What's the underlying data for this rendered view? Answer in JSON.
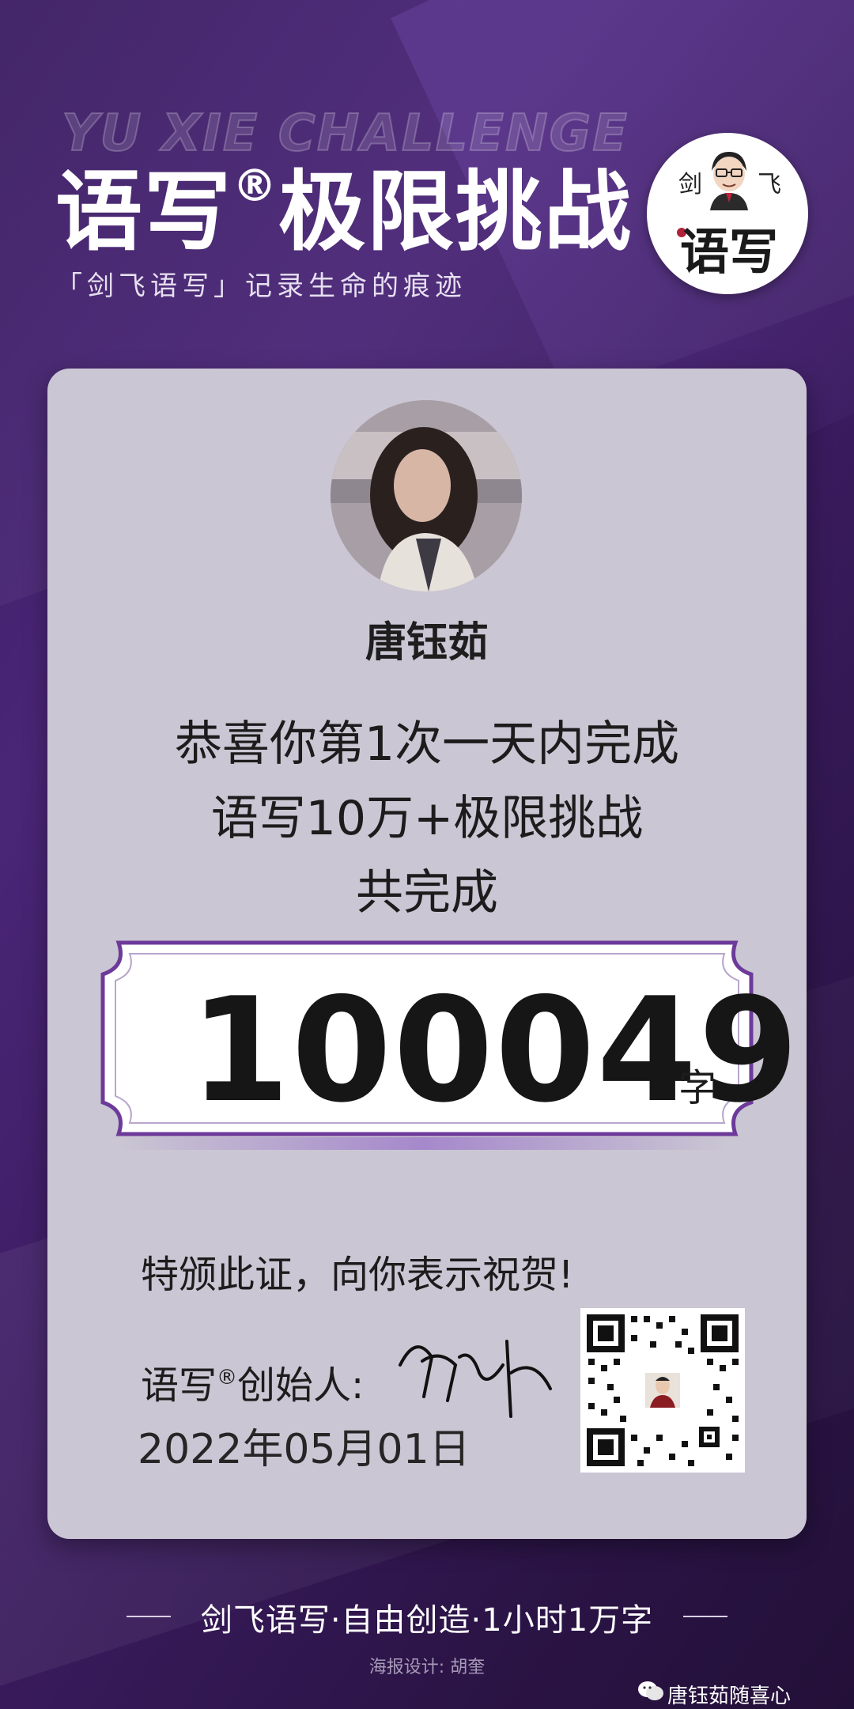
{
  "header": {
    "bg_title": "YU XIE CHALLENGE",
    "title_main": "语写",
    "title_reg": "®",
    "title_rest": "极限挑战",
    "subtitle": "「剑飞语写」记录生命的痕迹"
  },
  "logo": {
    "char1": "剑",
    "char2": "飞",
    "char3": "语写"
  },
  "profile": {
    "name": "唐钰茹"
  },
  "message": {
    "line1": "恭喜你第1次一天内完成",
    "line2": "语写10万+极限挑战",
    "line3": "共完成"
  },
  "count": {
    "value": "100049",
    "unit": "字"
  },
  "certificate": {
    "text": "特颁此证，向你表示祝贺!",
    "founder_prefix": "语写",
    "founder_reg": "®",
    "founder_suffix": "创始人:",
    "date": "2022年05月01日"
  },
  "footer": {
    "slogan": "剑飞语写·自由创造·1小时1万字",
    "designer": "海报设计: 胡奎",
    "watermark": "唐钰茹随喜心"
  },
  "colors": {
    "accent": "#6d3a9a",
    "background": "#3c1d63",
    "card": "#cac6d3"
  }
}
